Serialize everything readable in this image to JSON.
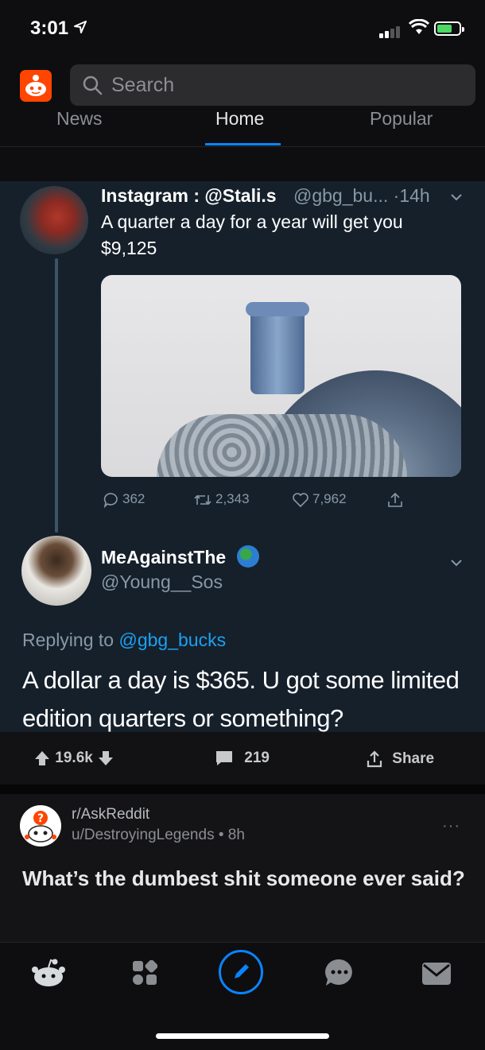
{
  "status_bar": {
    "time": "3:01"
  },
  "header": {
    "search_placeholder": "Search"
  },
  "tabs": [
    {
      "label": "News",
      "active": false
    },
    {
      "label": "Home",
      "active": true
    },
    {
      "label": "Popular",
      "active": false
    }
  ],
  "tweet": {
    "author": "Instagram : @Stali.s",
    "handle_time": "@gbg_bu... ·14h",
    "text": "A quarter a day for a year will get you $9,125",
    "stats": {
      "replies": "362",
      "retweets": "2,343",
      "likes": "7,962"
    }
  },
  "reply": {
    "name": "MeAgainstThe",
    "handle": "@Young__Sos",
    "replying_prefix": "Replying to",
    "replying_to": "@gbg_bucks",
    "text": "A dollar a day is $365. U got some limited edition quarters or something?"
  },
  "post_actions": {
    "votes": "19.6k",
    "comments": "219",
    "share_label": "Share"
  },
  "next_post": {
    "subreddit": "r/AskReddit",
    "user_time": "u/DestroyingLegends • 8h",
    "more": "···",
    "title": "What’s the dumbest shit someone ever said?"
  },
  "colors": {
    "accent": "#0a84ff",
    "brand": "#ff4500",
    "tweet_bg": "#15202b",
    "link": "#1da1f2"
  },
  "bottom_nav": [
    "home-icon",
    "communities-icon",
    "compose-icon",
    "chat-icon",
    "inbox-icon"
  ]
}
